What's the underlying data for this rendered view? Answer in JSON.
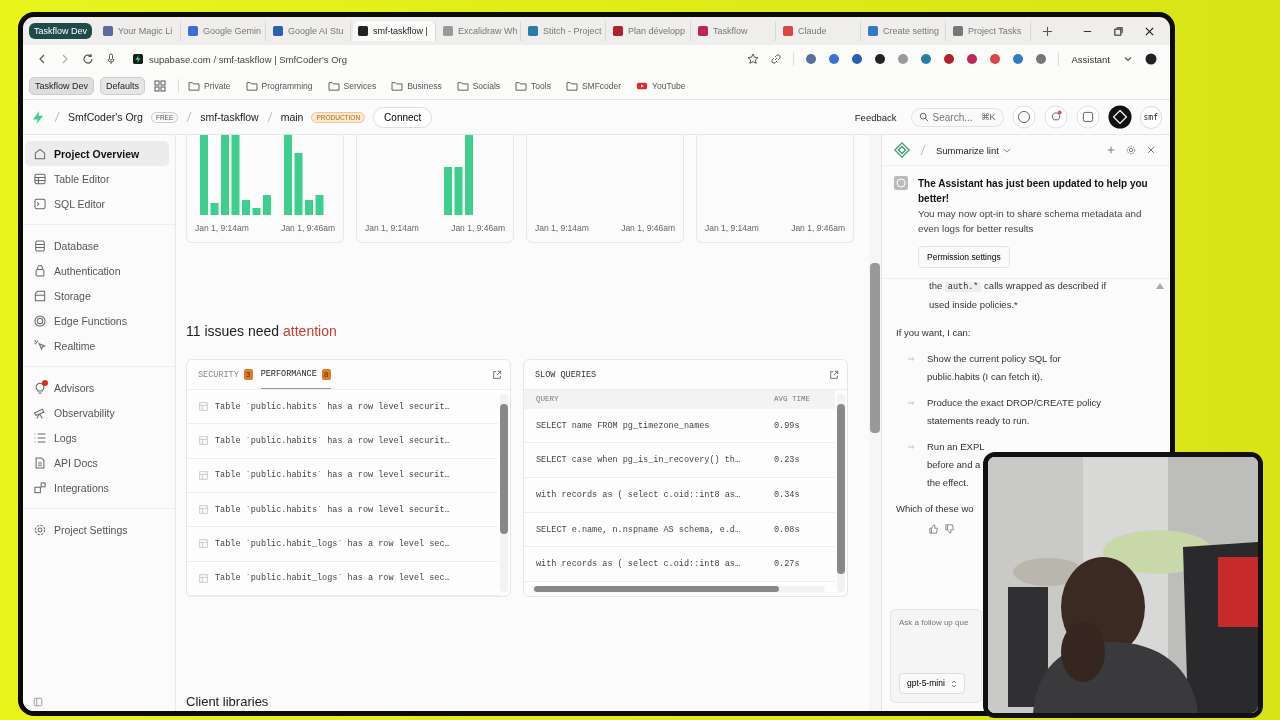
{
  "browser": {
    "tab_group": "Taskflow Dev",
    "tabs": [
      {
        "title": "Your Magic Li",
        "selected": false
      },
      {
        "title": "Google Gemin",
        "selected": false
      },
      {
        "title": "Google AI Stu",
        "selected": false
      },
      {
        "title": "smf-taskflow |",
        "selected": true
      },
      {
        "title": "Excalidraw Wh",
        "selected": false
      },
      {
        "title": "Stitch - Project",
        "selected": false
      },
      {
        "title": "Plan développ",
        "selected": false
      },
      {
        "title": "Taskflow",
        "selected": false
      },
      {
        "title": "Claude",
        "selected": false
      },
      {
        "title": "Create setting",
        "selected": false
      },
      {
        "title": "Project Tasks",
        "selected": false
      }
    ],
    "address": "supabase.com / smf-taskflow | SmfCoder's Org",
    "assistant_button": "Assistant"
  },
  "bookmarks": {
    "profile": "Taskflow Dev",
    "group": "Defaults",
    "folders": [
      "Private",
      "Programming",
      "Services",
      "Business",
      "Socials",
      "Tools",
      "SMFcoder"
    ],
    "link": "YouTube"
  },
  "header": {
    "org": "SmfCoder's Org",
    "plan": "FREE",
    "project": "smf-taskflow",
    "branch": "main",
    "environment": "PRODUCTION",
    "connect": "Connect",
    "feedback": "Feedback",
    "search": {
      "placeholder": "Search..."
    },
    "shortcut": "⌘K",
    "avatar": "smf"
  },
  "sidebar": {
    "groups": [
      [
        {
          "label": "Project Overview",
          "selected": true,
          "alert": false
        },
        {
          "label": "Table Editor",
          "selected": false,
          "alert": false
        },
        {
          "label": "SQL Editor",
          "selected": false,
          "alert": false
        }
      ],
      [
        {
          "label": "Database",
          "selected": false,
          "alert": false
        },
        {
          "label": "Authentication",
          "selected": false,
          "alert": false
        },
        {
          "label": "Storage",
          "selected": false,
          "alert": false
        },
        {
          "label": "Edge Functions",
          "selected": false,
          "alert": false
        },
        {
          "label": "Realtime",
          "selected": false,
          "alert": false
        }
      ],
      [
        {
          "label": "Advisors",
          "selected": false,
          "alert": true
        },
        {
          "label": "Observability",
          "selected": false,
          "alert": false
        },
        {
          "label": "Logs",
          "selected": false,
          "alert": false
        },
        {
          "label": "API Docs",
          "selected": false,
          "alert": false
        },
        {
          "label": "Integrations",
          "selected": false,
          "alert": false
        }
      ],
      [
        {
          "label": "Project Settings",
          "selected": false,
          "alert": false
        }
      ]
    ]
  },
  "charts": [
    {
      "start": "Jan 1, 9:14am",
      "end": "Jan 1, 9:46am"
    },
    {
      "start": "Jan 1, 9:14am",
      "end": "Jan 1, 9:46am"
    },
    {
      "start": "Jan 1, 9:14am",
      "end": "Jan 1, 9:46am"
    },
    {
      "start": "Jan 1, 9:14am",
      "end": "Jan 1, 9:46am"
    }
  ],
  "issues": {
    "title": "11 issues need",
    "highlight": "attention"
  },
  "advisor": {
    "tabs": [
      {
        "label": "SECURITY",
        "count": "3",
        "selected": false
      },
      {
        "label": "PERFORMANCE",
        "count": "8",
        "selected": true
      }
    ],
    "rows": [
      "Table `public.habits` has a row level securit…",
      "Table `public.habits` has a row level securit…",
      "Table `public.habits` has a row level securit…",
      "Table `public.habits` has a row level securit…",
      "Table `public.habit_logs` has a row level sec…",
      "Table `public.habit_logs` has a row level sec…"
    ]
  },
  "slow_queries": {
    "title": "SLOW QUERIES",
    "columns": [
      "QUERY",
      "AVG TIME"
    ],
    "rows": [
      {
        "query": "SELECT name FROM pg_timezone_names",
        "avg_time": "0.99s"
      },
      {
        "query": "SELECT case when pg_is_in_recovery() th…",
        "avg_time": "0.23s"
      },
      {
        "query": "with records as ( select c.oid::int8 as…",
        "avg_time": "0.34s"
      },
      {
        "query": "SELECT e.name, n.nspname AS schema, e.d…",
        "avg_time": "0.08s"
      },
      {
        "query": "with records as ( select c.oid::int8 as…",
        "avg_time": "0.27s"
      }
    ]
  },
  "client_libraries": "Client libraries",
  "assistant": {
    "title": "Summarize lint",
    "notice": {
      "title": "The Assistant has just been updated to help you better!",
      "text": "You may now opt-in to share schema metadata and even logs for better results",
      "button": "Permission settings"
    },
    "continuation": {
      "before": "the",
      "code": "auth.*",
      "after": "calls wrapped as described if used inside policies.*"
    },
    "intro": "If you want, I can:",
    "options": [
      [
        "Show the current policy SQL for",
        "public.habits (I can fetch it)."
      ],
      [
        "Produce the exact DROP/CREATE policy",
        "statements ready to run."
      ],
      [
        "Run an EXPL",
        "before and a",
        "the effect."
      ]
    ],
    "question": "Which of these wo",
    "input": {
      "placeholder": "Ask a follow up que"
    },
    "model": "gpt-5-mini"
  }
}
